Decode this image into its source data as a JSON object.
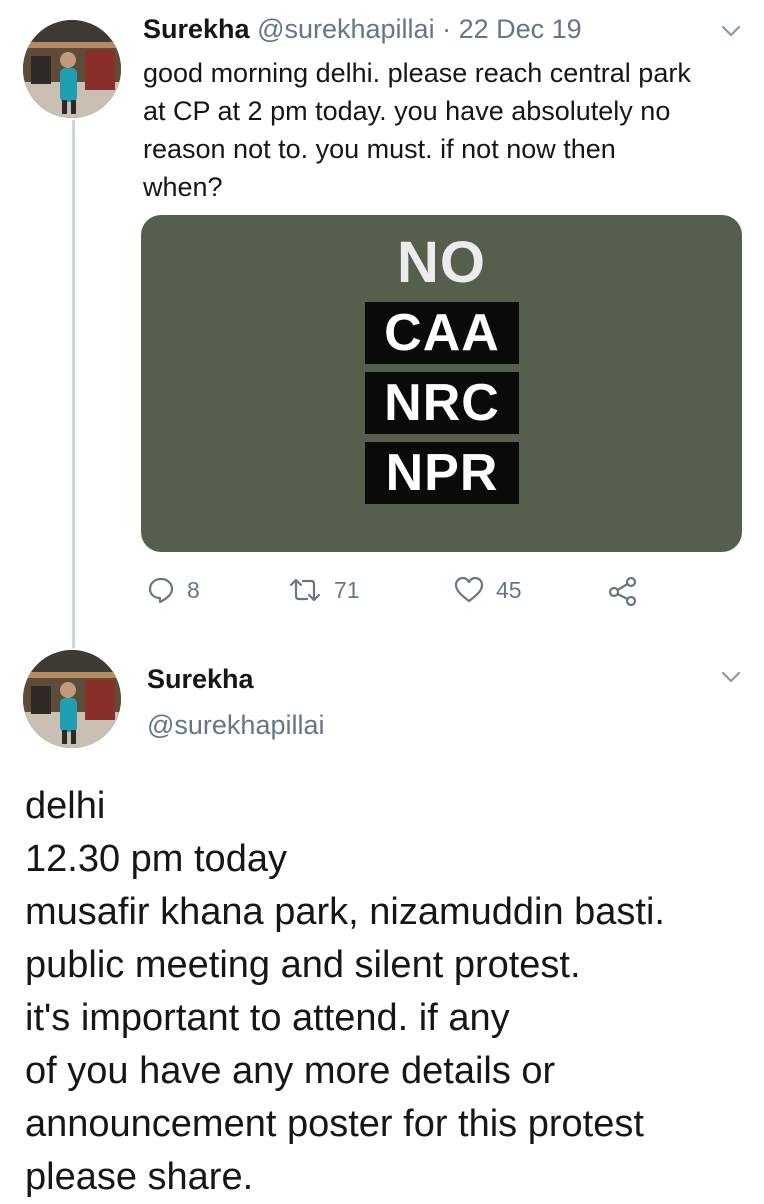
{
  "colors": {
    "text": "#14171a",
    "secondary": "#657786",
    "thread_line": "#ccd6dd",
    "media_background": "#565e4e",
    "tag_background": "#0a0a0a"
  },
  "tweet1": {
    "author_name": "Surekha",
    "author_handle": "@surekhapillai",
    "date": "· 22 Dec 19",
    "text": "good morning delhi. please reach central park\nat CP at 2 pm today. you have absolutely no\nreason not to. you must. if not now then\nwhen?",
    "media": {
      "headline": "NO",
      "tags": [
        "CAA",
        "NRC",
        "NPR"
      ]
    },
    "actions": {
      "reply_icon": "reply-icon",
      "reply_count": "8",
      "retweet_icon": "retweet-icon",
      "retweet_count": "71",
      "like_icon": "heart-icon",
      "like_count": "45",
      "share_icon": "share-icon"
    }
  },
  "tweet2": {
    "author_name": "Surekha",
    "author_handle": "@surekhapillai",
    "text": "delhi\n12.30 pm today\nmusafir khana park, nizamuddin basti.\npublic meeting and silent protest.\nit's important to attend. if any\nof you have any more details or\nannouncement poster for this protest\nplease share."
  }
}
